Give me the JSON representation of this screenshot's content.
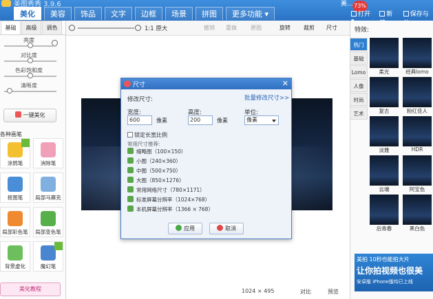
{
  "app": {
    "title": "美图秀秀 3.9.6",
    "user": "美...",
    "badge": "73%"
  },
  "main_tabs": [
    "美化",
    "美容",
    "饰品",
    "文字",
    "边框",
    "场景",
    "拼图",
    "更多功能 ▾"
  ],
  "top_actions": [
    "打开 ▾",
    "新建",
    "保存与分"
  ],
  "left": {
    "sub_tabs": [
      "基础",
      "高级",
      "调色"
    ],
    "sliders": [
      {
        "label": "亮度",
        "value": 0.5
      },
      {
        "label": "对比度",
        "value": 0.5
      },
      {
        "label": "色彩饱和度",
        "value": 0.5
      },
      {
        "label": "清晰度",
        "value": 0.1
      }
    ],
    "oneclick": "一键美化",
    "brush_title": "各种画笔",
    "brushes": [
      "涂鸦笔",
      "消除笔",
      "抠图笔",
      "局部马赛克",
      "局部彩色笔",
      "局部变色笔",
      "背景虚化",
      "魔幻笔"
    ],
    "tutorial": "美化教程"
  },
  "toolbar": {
    "zoom_label": "1:1 原大",
    "items": [
      "撤销",
      "重做",
      "原图",
      "旋转",
      "裁剪",
      "尺寸"
    ]
  },
  "status": {
    "size": "1024 × 495",
    "compare": "对比",
    "preview": "预览"
  },
  "right": {
    "title": "特效:",
    "tabs": [
      "热门",
      "基础",
      "Lomo",
      "人像",
      "时尚",
      "艺术"
    ],
    "effects": [
      "柔光",
      "经典lomo",
      "复古",
      "粉红佳人",
      "淡雅",
      "HDR",
      "云端",
      "阿宝色",
      "后青春",
      "黑白色"
    ],
    "ad": {
      "line1": "美拍 10秒也能拍大片",
      "line2": "让你拍视频也很美",
      "line3": "安卓版  iPhone版均已上线"
    }
  },
  "dialog": {
    "title": "尺寸",
    "section": "修改尺寸:",
    "batch_link": "批量修改尺寸>>",
    "width_label": "宽度:",
    "width_value": "600",
    "height_label": "高度:",
    "height_value": "200",
    "px_unit": "像素",
    "unit_label": "单位:",
    "unit_value": "像素",
    "lock_ratio": "锁定长宽比例",
    "preset_title": "常用尺寸推荐:",
    "presets": [
      "缩略图（100×150）",
      "小图（240×360）",
      "中图（500×750）",
      "大图（850×1276）",
      "常用网络尺寸（780×1171）",
      "标准屏幕分辨率（1024×768）",
      "本机屏幕分辨率（1366 × 768）"
    ],
    "apply": "应用",
    "cancel": "取消"
  }
}
